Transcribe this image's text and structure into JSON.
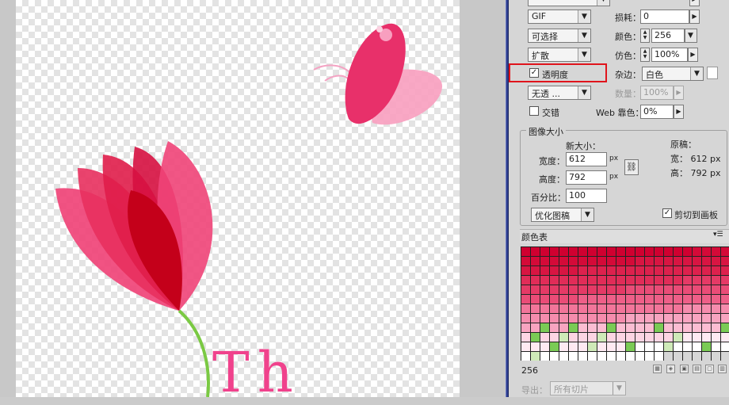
{
  "canvas": {
    "artwork_text": "Th",
    "colors": {
      "petal_dark": "#c4001a",
      "petal_mid": "#e2123f",
      "petal_light": "#f04478",
      "stem": "#7ac943",
      "text_pink": "#f0428c",
      "wing": "#e8306a",
      "wing_light": "#f89fbf"
    }
  },
  "settings": {
    "preset_cut_label": "",
    "format": "GIF",
    "loss_label": "损耗：",
    "loss_value": "0",
    "selective_label": "可选择",
    "colors_label": "颜色：",
    "colors_value": "256",
    "diffusion_label": "扩散",
    "dither_label": "仿色：",
    "dither_value": "100%",
    "transparency_label": "透明度",
    "transparency_checked": "✓",
    "matte_label": "杂边：",
    "matte_value": "白色",
    "no_transparency_dither": "无透 ...",
    "amount_label": "数量：",
    "amount_value": "100%",
    "interlaced_label": "交错",
    "web_snap_label": "Web 靠色：",
    "web_snap_value": "0%"
  },
  "image_size": {
    "group_title": "图像大小",
    "new_size_label": "新大小：",
    "width_label": "宽度：",
    "width_value": "612",
    "height_label": "高度：",
    "height_value": "792",
    "unit": "px",
    "percent_label": "百分比：",
    "percent_value": "100",
    "quality": "优化图稿",
    "original_label": "原稿：",
    "original_width": "宽： 612 px",
    "original_height": "高： 792 px",
    "clip_label": "剪切到画板",
    "clip_checked": "✓"
  },
  "color_table": {
    "title": "颜色表",
    "menu_icon": "▾☰",
    "count": "256",
    "export_label": "导出：",
    "export_value": "所有切片",
    "palette": [
      "#d00030",
      "#d40a38",
      "#d81542",
      "#dd214d",
      "#e12c58",
      "#e53a66",
      "#ea4c77",
      "#ee5f88",
      "#f2759a",
      "#f58cad",
      "#f8a4c0",
      "#fbbdd2",
      "#fdd5e3",
      "#feeaf2",
      "#ffffff"
    ],
    "accents": {
      "green": "#7acb55",
      "pale_green": "#cfeab8"
    }
  }
}
